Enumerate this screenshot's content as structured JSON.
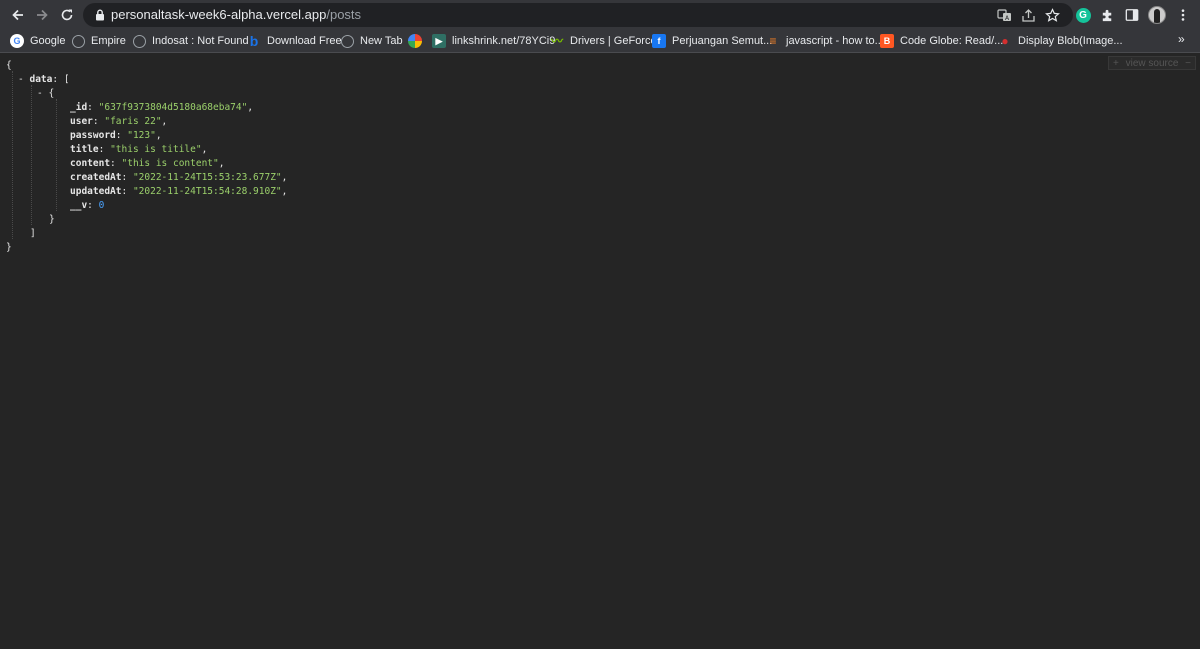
{
  "browser": {
    "url_host": "personaltask-week6-alpha.vercel.app",
    "url_path": "/posts",
    "icons": {
      "back": "arrow-left-icon",
      "forward": "arrow-right-icon",
      "reload": "reload-icon",
      "lock": "lock-icon",
      "translate": "translate-icon",
      "share": "share-icon",
      "bookmark_star": "star-icon",
      "grammarly": "grammarly-icon",
      "extensions": "puzzle-icon",
      "side_panel": "side-panel-icon",
      "profile": "avatar",
      "menu": "kebab-menu-icon"
    },
    "grammarly_letter": "G"
  },
  "bookmarks": [
    {
      "label": "Google",
      "icon": "google-icon",
      "color": "#ffffff",
      "glyph": "G"
    },
    {
      "label": "Empire",
      "icon": "globe-icon",
      "color": "#9aa0a6",
      "glyph": ""
    },
    {
      "label": "Indosat : Not Found",
      "icon": "globe-icon",
      "color": "#9aa0a6",
      "glyph": ""
    },
    {
      "label": "Download Free",
      "icon": "download-free-icon",
      "color": "#1a73e8",
      "glyph": "b"
    },
    {
      "label": "New Tab",
      "icon": "globe-icon",
      "color": "#9aa0a6",
      "glyph": ""
    },
    {
      "label": "",
      "icon": "multicolor-circle-icon",
      "color": "#f4b400",
      "glyph": ""
    },
    {
      "label": "linkshrink.net/78YCi9",
      "icon": "linkshrink-icon",
      "color": "#2f6f64",
      "glyph": "▶"
    },
    {
      "label": "Drivers | GeForce",
      "icon": "nvidia-icon",
      "color": "#76b900",
      "glyph": "〰"
    },
    {
      "label": "Perjuangan Semut...",
      "icon": "facebook-icon",
      "color": "#1877f2",
      "glyph": "f"
    },
    {
      "label": "javascript - how to...",
      "icon": "stackoverflow-icon",
      "color": "#f48024",
      "glyph": "≡"
    },
    {
      "label": "Code Globe: Read/...",
      "icon": "blogger-icon",
      "color": "#ff5722",
      "glyph": "B"
    },
    {
      "label": "Display Blob(Image...",
      "icon": "red-circle-icon",
      "color": "#d32f2f",
      "glyph": "●"
    }
  ],
  "bookmarks_overflow": "»",
  "viewer": {
    "view_source_label": "view source",
    "plus": "+",
    "minus": "−",
    "open_brace": "{",
    "close_brace": "}",
    "collapse_marker": "-",
    "data_key": "data",
    "open_bracket": "[",
    "close_bracket": "]",
    "fields": [
      {
        "key": "_id",
        "value": "\"637f9373804d5180a68eba74\"",
        "type": "string"
      },
      {
        "key": "user",
        "value": "\"faris 22\"",
        "type": "string"
      },
      {
        "key": "password",
        "value": "\"123\"",
        "type": "string"
      },
      {
        "key": "title",
        "value": "\"this is titile\"",
        "type": "string"
      },
      {
        "key": "content",
        "value": "\"this is content\"",
        "type": "string"
      },
      {
        "key": "createdAt",
        "value": "\"2022-11-24T15:53:23.677Z\"",
        "type": "string"
      },
      {
        "key": "updatedAt",
        "value": "\"2022-11-24T15:54:28.910Z\"",
        "type": "string"
      },
      {
        "key": "__v",
        "value": "0",
        "type": "number"
      }
    ]
  }
}
